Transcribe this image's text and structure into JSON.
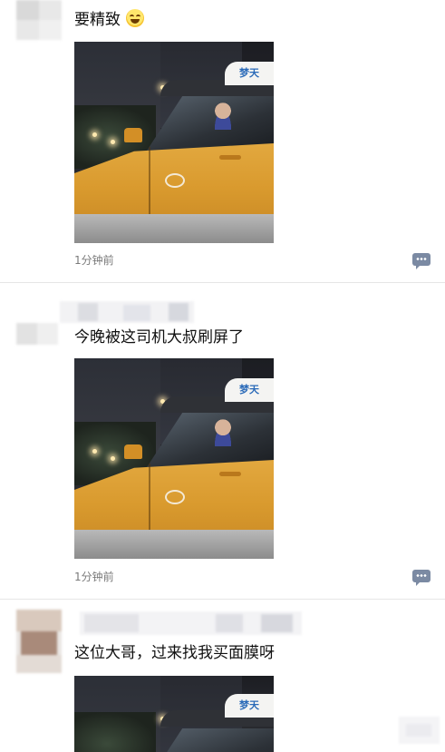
{
  "posts": [
    {
      "text": "要精致",
      "emoji": "laughing-emoji",
      "time": "1分钟前",
      "photo_sign": "梦天"
    },
    {
      "text": "今晚被这司机大叔刷屏了",
      "time": "1分钟前",
      "photo_sign": "梦天"
    },
    {
      "text": "这位大哥，过来找我买面膜呀",
      "photo_sign": "梦天"
    }
  ],
  "icons": {
    "comment": "comment-icon"
  },
  "colors": {
    "comment_icon": "#7b8aa3",
    "time_text": "#7a7a7a",
    "divider": "#e6e6e6"
  }
}
